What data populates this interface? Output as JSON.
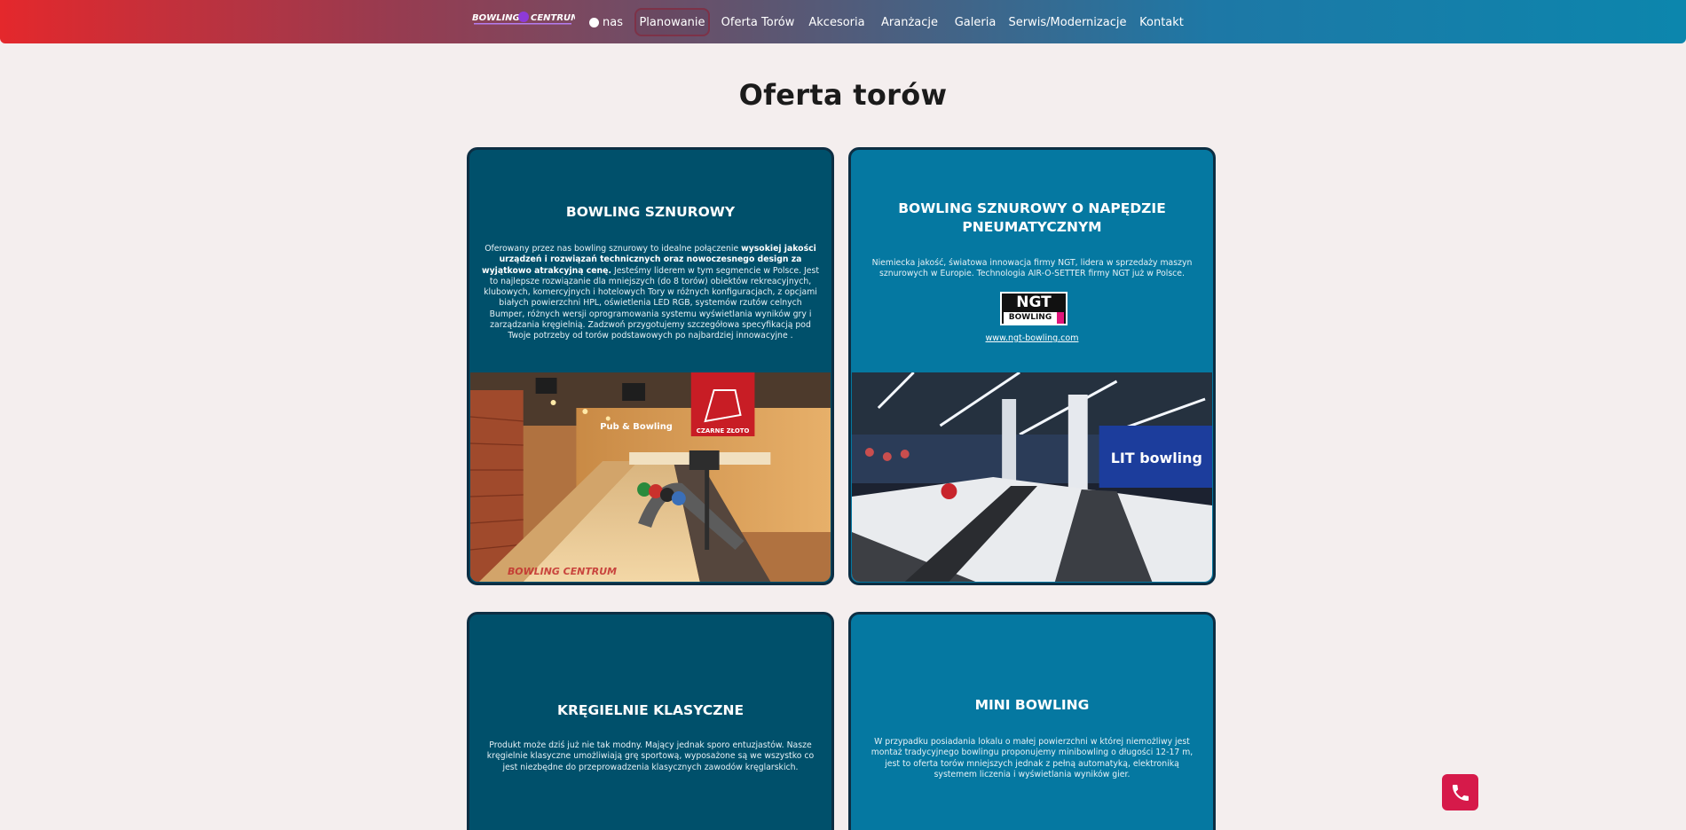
{
  "nav": {
    "logo_text": "BOWLING CENTRUM",
    "items": [
      {
        "label": "nas",
        "icon": "circle-icon"
      },
      {
        "label": "Planowanie",
        "active": true
      },
      {
        "label": "Oferta Torów"
      },
      {
        "label": "Akcesoria"
      },
      {
        "label": "Aranżacje"
      },
      {
        "label": "Galeria"
      },
      {
        "label": "Serwis/Modernizacje"
      },
      {
        "label": "Kontakt"
      }
    ]
  },
  "page_title": "Oferta torów",
  "cards": [
    {
      "title": "BOWLING SZNUROWY",
      "text_intro": "Oferowany przez nas bowling sznurowy to idealne połączenie ",
      "text_bold": "wysokiej jakości urządzeń i rozwiązań technicznych oraz nowoczesnego design za wyjątkowo atrakcyjną cenę.",
      "text_rest": " Jesteśmy liderem w tym segmencie w Polsce. Jest to najlepsze rozwiązanie dla mniejszych (do 8 torów) obiektów rekreacyjnych, klubowych, komercyjnych i hotelowych Tory w różnych konfiguracjach, z opcjami białych powierzchni HPL, oświetlenia LED RGB, systemów rzutów celnych Bumper, różnych wersji oprogramowania systemu wyświetlania wyników gry i zarządzania kręgielnią. Zadzwoń przygotujemy szczegółowa specyfikacją pod Twoje potrzeby od torów podstawowych po najbardziej innowacyjne .",
      "image_caption": "Pub & Bowling",
      "image_badge": "CZARNE ZŁOTO",
      "image_watermark": "BOWLING CENTRUM"
    },
    {
      "title": "BOWLING SZNUROWY O NAPĘDZIE PNEUMATYCZNYM",
      "text": "Niemiecka jakość, światowa innowacja firmy NGT, lidera w sprzedaży maszyn sznurowych w Europie. Technologia AIR-O-SETTER firmy NGT już w Polsce.",
      "logo_top": "NGT",
      "logo_bottom": "BOWLING",
      "link": "www.ngt-bowling.com",
      "image_sign": "LIT bowling"
    },
    {
      "title": "KRĘGIELNIE KLASYCZNE",
      "text": "Produkt może dziś już nie tak modny. Mający jednak sporo entuzjastów. Nasze kręgielnie klasyczne umożliwiają grę sportową, wyposażone są we wszystko co jest niezbędne do przeprowadzenia klasycznych zawodów kręglarskich."
    },
    {
      "title": "MINI BOWLING",
      "text": "W przypadku posiadania lokalu o małej powierzchni w której niemożliwy jest montaż tradycyjnego bowlingu proponujemy minibowling o długości 12-17 m, jest to oferta torów mniejszych jednak z pełną automatyką, elektroniką systemem liczenia i wyświetlania wyników gier."
    }
  ],
  "colors": {
    "card_dark": "#00506b",
    "card_light": "#0578a1",
    "phone_button": "#d61a4a",
    "nav_gradient_start": "#e4282c",
    "nav_gradient_end": "#0c86ad"
  },
  "phone_button_icon": "phone-icon"
}
